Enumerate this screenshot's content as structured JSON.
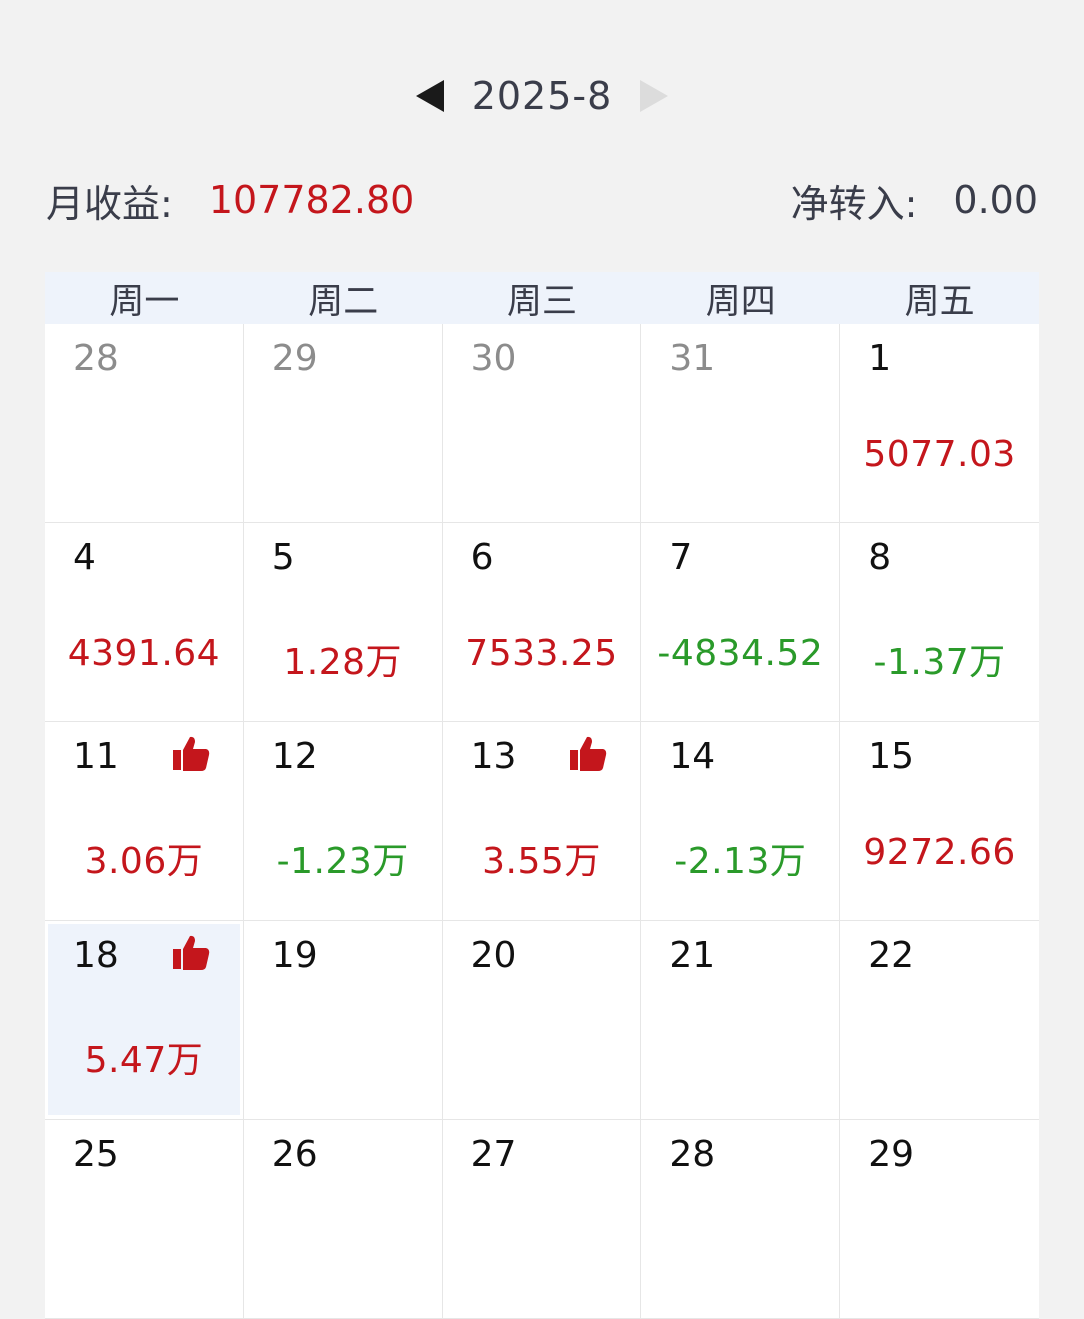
{
  "header": {
    "month": "2025-8",
    "prev_icon": "triangle-left-icon",
    "next_icon": "triangle-right-icon"
  },
  "summary": {
    "monthly_label": "月收益:",
    "monthly_value": "107782.80",
    "transfer_label": "净转入:",
    "transfer_value": "0.00"
  },
  "weekdays": [
    "周一",
    "周二",
    "周三",
    "周四",
    "周五"
  ],
  "colors": {
    "gain": "#c4161c",
    "loss": "#2a9a2a",
    "header_bg": "#eef3fb"
  },
  "days": [
    {
      "day": "28",
      "other": true
    },
    {
      "day": "29",
      "other": true
    },
    {
      "day": "30",
      "other": true
    },
    {
      "day": "31",
      "other": true
    },
    {
      "day": "1",
      "value": "5077.03",
      "sign": "pos"
    },
    {
      "day": "4",
      "value": "4391.64",
      "sign": "pos"
    },
    {
      "day": "5",
      "value": "1.28万",
      "sign": "pos"
    },
    {
      "day": "6",
      "value": "7533.25",
      "sign": "pos"
    },
    {
      "day": "7",
      "value": "-4834.52",
      "sign": "neg"
    },
    {
      "day": "8",
      "value": "-1.37万",
      "sign": "neg"
    },
    {
      "day": "11",
      "value": "3.06万",
      "sign": "pos",
      "thumb": true
    },
    {
      "day": "12",
      "value": "-1.23万",
      "sign": "neg"
    },
    {
      "day": "13",
      "value": "3.55万",
      "sign": "pos",
      "thumb": true
    },
    {
      "day": "14",
      "value": "-2.13万",
      "sign": "neg"
    },
    {
      "day": "15",
      "value": "9272.66",
      "sign": "pos"
    },
    {
      "day": "18",
      "value": "5.47万",
      "sign": "pos",
      "thumb": true,
      "selected": true
    },
    {
      "day": "19"
    },
    {
      "day": "20"
    },
    {
      "day": "21"
    },
    {
      "day": "22"
    },
    {
      "day": "25"
    },
    {
      "day": "26"
    },
    {
      "day": "27"
    },
    {
      "day": "28"
    },
    {
      "day": "29"
    }
  ]
}
